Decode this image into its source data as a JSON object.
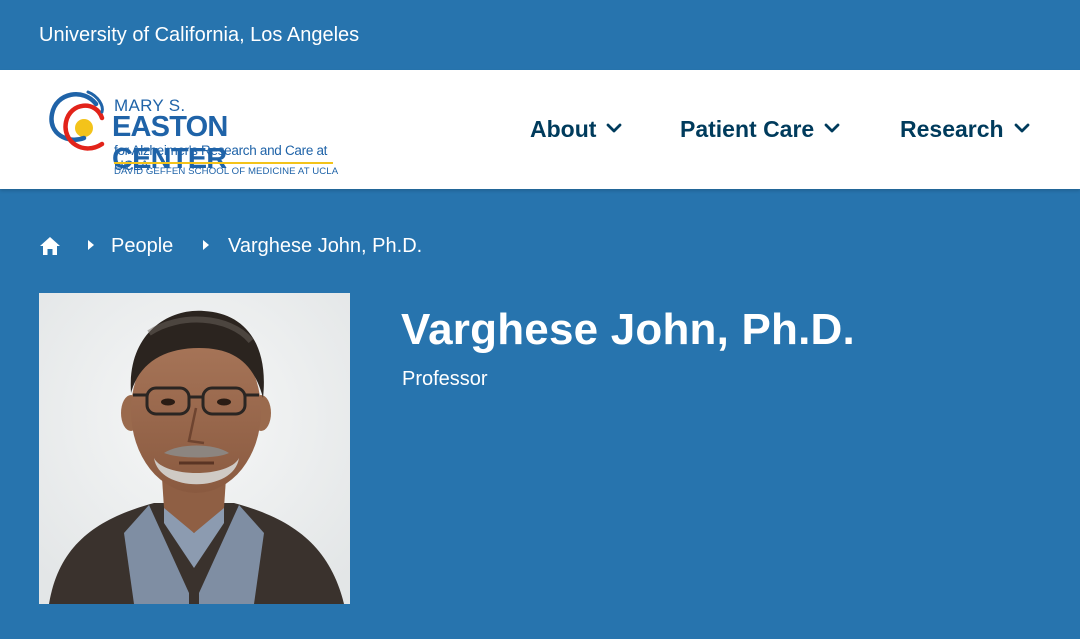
{
  "topbar": {
    "university": "University of California, Los Angeles"
  },
  "logo": {
    "line1": "MARY S.",
    "line2": "EASTON CENTER",
    "line3": "for Alzheimer's Research and Care at UCLA",
    "line4": "DAVID GEFFEN SCHOOL OF MEDICINE AT UCLA"
  },
  "nav": {
    "items": [
      {
        "label": "About"
      },
      {
        "label": "Patient Care"
      },
      {
        "label": "Research"
      }
    ]
  },
  "breadcrumb": {
    "home_icon": "home-icon",
    "items": [
      {
        "label": "People"
      },
      {
        "label": "Varghese John, Ph.D."
      }
    ]
  },
  "profile": {
    "name": "Varghese John, Ph.D.",
    "title": "Professor"
  },
  "colors": {
    "brand_blue": "#2774ae",
    "nav_text": "#003b5c",
    "logo_blue": "#1f63a8",
    "logo_gold": "#f3c31a",
    "logo_red": "#e2231a"
  }
}
